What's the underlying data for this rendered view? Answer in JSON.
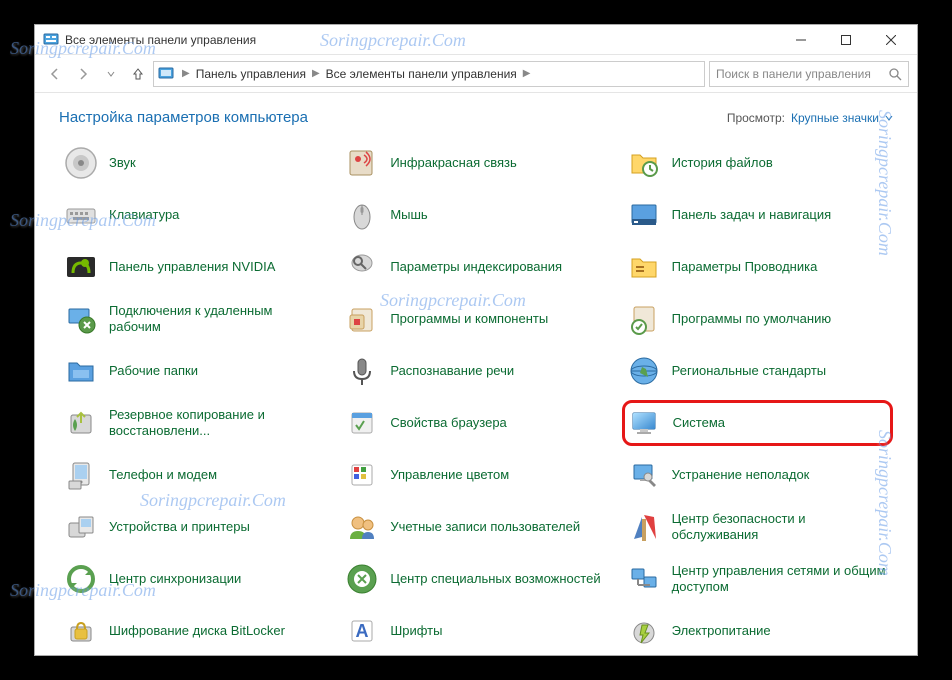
{
  "watermark": "Soringpcrepair.Com",
  "window": {
    "title": "Все элементы панели управления"
  },
  "nav": {
    "crumb1": "Панель управления",
    "crumb2": "Все элементы панели управления",
    "search_placeholder": "Поиск в панели управления"
  },
  "header": {
    "title": "Настройка параметров компьютера",
    "view_label": "Просмотр:",
    "view_value": "Крупные значки"
  },
  "items": [
    [
      {
        "k": "sound",
        "label": "Звук"
      },
      {
        "k": "infrared",
        "label": "Инфракрасная связь"
      },
      {
        "k": "filehistory",
        "label": "История файлов"
      }
    ],
    [
      {
        "k": "keyboard",
        "label": "Клавиатура"
      },
      {
        "k": "mouse",
        "label": "Мышь"
      },
      {
        "k": "taskbar",
        "label": "Панель задач и навигация"
      }
    ],
    [
      {
        "k": "nvidia",
        "label": "Панель управления NVIDIA"
      },
      {
        "k": "indexing",
        "label": "Параметры индексирования"
      },
      {
        "k": "explorer",
        "label": "Параметры Проводника"
      }
    ],
    [
      {
        "k": "remote",
        "label": "Подключения к удаленным рабочим"
      },
      {
        "k": "programs",
        "label": "Программы и компоненты"
      },
      {
        "k": "defaults",
        "label": "Программы по умолчанию"
      }
    ],
    [
      {
        "k": "workfolders",
        "label": "Рабочие папки"
      },
      {
        "k": "speech",
        "label": "Распознавание речи"
      },
      {
        "k": "region",
        "label": "Региональные стандарты"
      }
    ],
    [
      {
        "k": "backup",
        "label": "Резервное копирование и восстановлени..."
      },
      {
        "k": "browser",
        "label": "Свойства браузера"
      },
      {
        "k": "system",
        "label": "Система",
        "hl": true
      }
    ],
    [
      {
        "k": "phone",
        "label": "Телефон и модем"
      },
      {
        "k": "color",
        "label": "Управление цветом"
      },
      {
        "k": "troubleshoot",
        "label": "Устранение неполадок"
      }
    ],
    [
      {
        "k": "devices",
        "label": "Устройства и принтеры"
      },
      {
        "k": "users",
        "label": "Учетные записи пользователей"
      },
      {
        "k": "security",
        "label": "Центр безопасности и обслуживания"
      }
    ],
    [
      {
        "k": "sync",
        "label": "Центр синхронизации"
      },
      {
        "k": "ease",
        "label": "Центр специальных возможностей"
      },
      {
        "k": "network",
        "label": "Центр управления сетями и общим доступом"
      }
    ],
    [
      {
        "k": "bitlocker",
        "label": "Шифрование диска BitLocker"
      },
      {
        "k": "fonts",
        "label": "Шрифты"
      },
      {
        "k": "power",
        "label": "Электропитание"
      }
    ]
  ]
}
